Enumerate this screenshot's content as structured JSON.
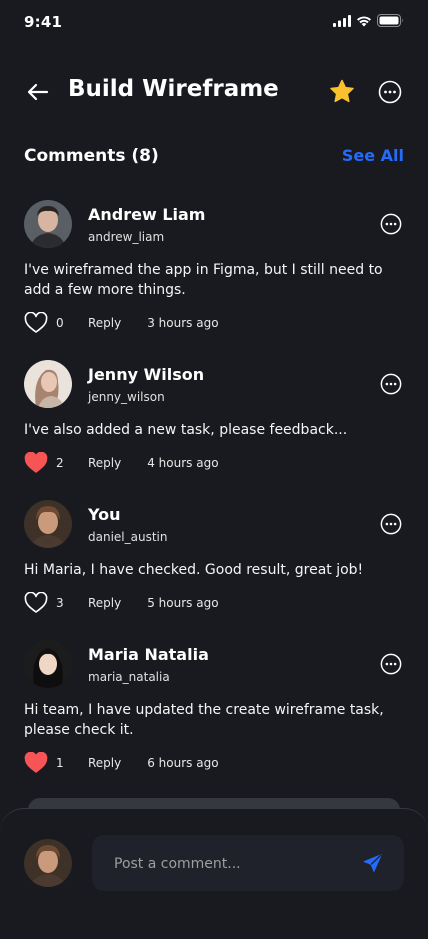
{
  "status_bar": {
    "time": "9:41"
  },
  "header": {
    "title": "Build Wireframe",
    "back_icon": "arrow-left-icon",
    "star_icon": "star-icon",
    "more_icon": "more-circle-icon"
  },
  "comments_section": {
    "title": "Comments (8)",
    "see_all": "See All",
    "accent_color": "#246bfd"
  },
  "comments": [
    {
      "name": "Andrew Liam",
      "username": "andrew_liam",
      "text": "I've wireframed the app in Figma, but I still need to add a few more things.",
      "likes": "0",
      "liked": false,
      "reply": "Reply",
      "time": "3 hours ago"
    },
    {
      "name": "Jenny Wilson",
      "username": "jenny_wilson",
      "text": "I've also added a new task, please feedback...",
      "likes": "2",
      "liked": true,
      "reply": "Reply",
      "time": "4 hours ago"
    },
    {
      "name": "You",
      "username": "daniel_austin",
      "text": "Hi Maria, I have checked. Good result, great job!",
      "likes": "3",
      "liked": false,
      "reply": "Reply",
      "time": "5 hours ago"
    },
    {
      "name": "Maria Natalia",
      "username": "maria_natalia",
      "text": "Hi team, I have updated the create wireframe task, please check it.",
      "likes": "1",
      "liked": true,
      "reply": "Reply",
      "time": "6 hours ago"
    }
  ],
  "composer": {
    "placeholder": "Post a comment...",
    "value": "",
    "send_icon": "send-icon"
  },
  "colors": {
    "background": "#181a20",
    "liked_heart": "#f75555",
    "star": "#fbc02d"
  }
}
